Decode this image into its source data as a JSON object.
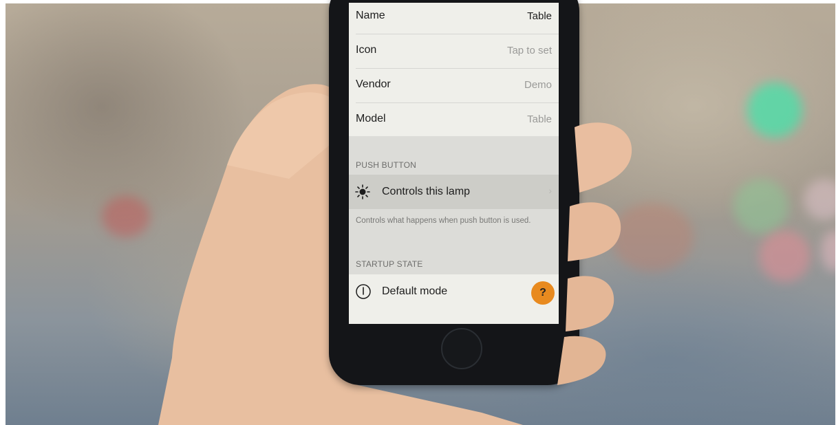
{
  "settings": [
    {
      "label": "Name",
      "value": "Table"
    },
    {
      "label": "Icon",
      "value": "Tap to set"
    },
    {
      "label": "Vendor",
      "value": "Demo"
    },
    {
      "label": "Model",
      "value": "Table"
    }
  ],
  "push_button": {
    "header": "PUSH BUTTON",
    "icon": "sun-icon",
    "row_label": "Controls this lamp",
    "description": "Controls what happens when push button is used."
  },
  "startup_state": {
    "header": "STARTUP STATE",
    "icon": "power-icon",
    "row_label": "Default mode",
    "help_label": "?",
    "help_color": "#e88a1f"
  }
}
